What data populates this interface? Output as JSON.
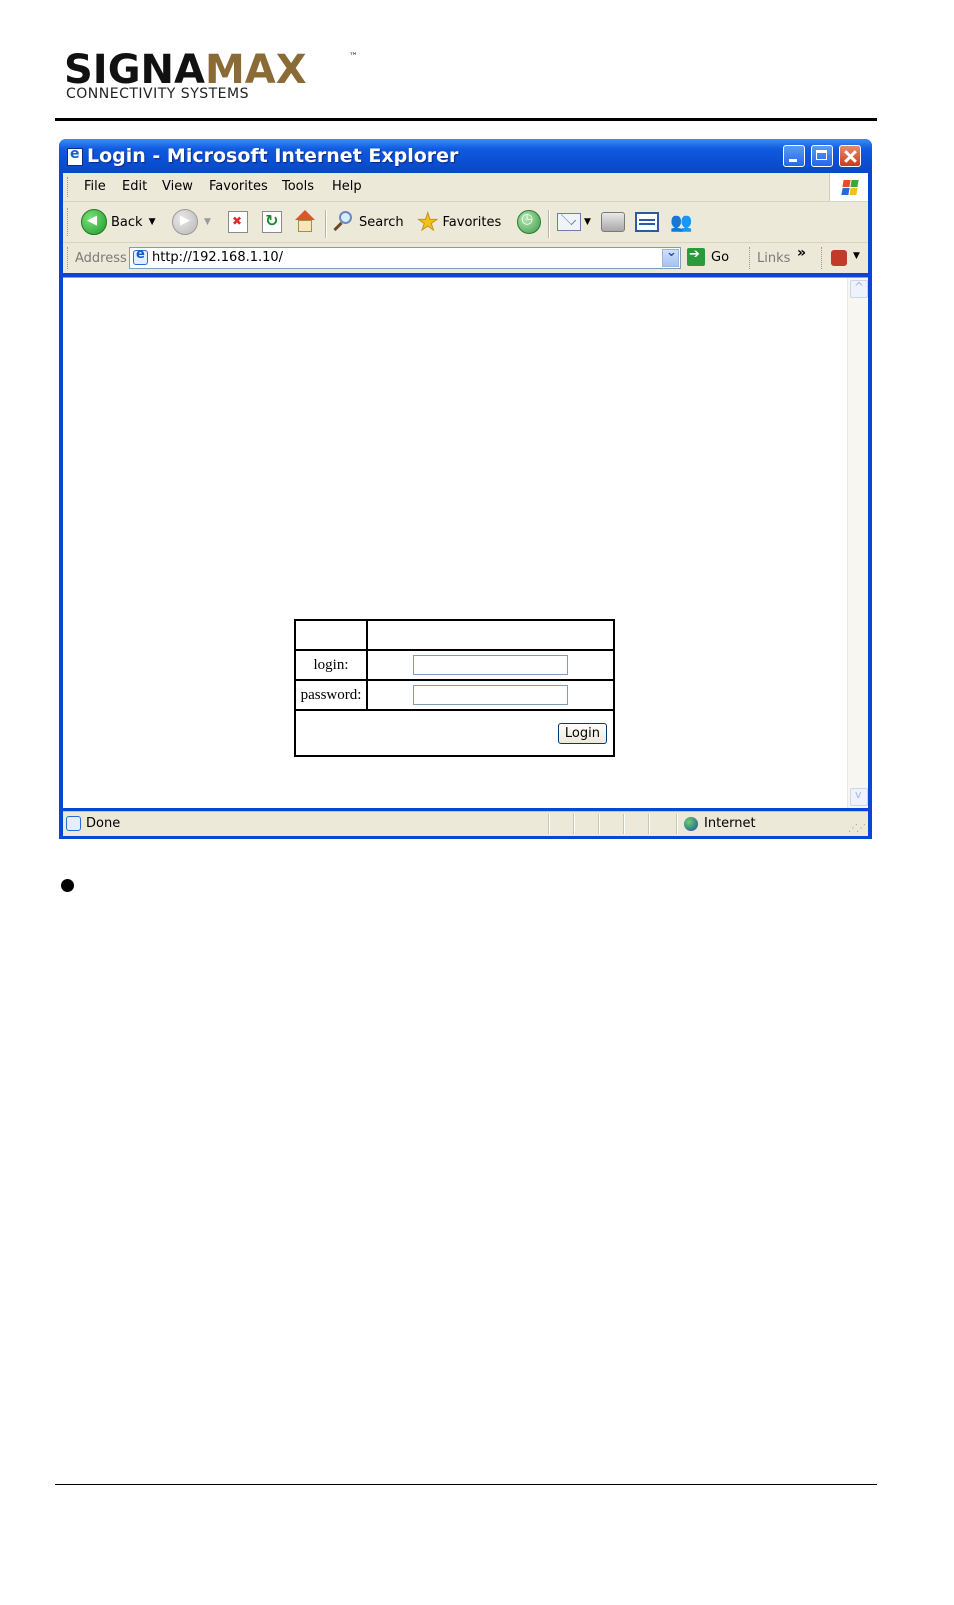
{
  "logo": {
    "word_dark": "SIGNA",
    "word_gold": "MAX",
    "tm": "™",
    "subtitle": "CONNECTIVITY SYSTEMS"
  },
  "window": {
    "title": "Login - Microsoft Internet Explorer"
  },
  "menu": [
    "File",
    "Edit",
    "View",
    "Favorites",
    "Tools",
    "Help"
  ],
  "toolbar": {
    "back_label": "Back",
    "search_label": "Search",
    "favorites_label": "Favorites"
  },
  "address_bar": {
    "label": "Address",
    "url": "http://192.168.1.10/",
    "go_label": "Go",
    "links_label": "Links",
    "links_more": "»"
  },
  "login_form": {
    "login_label": "login:",
    "password_label": "password:",
    "login_value": "",
    "password_value": "",
    "submit_label": "Login"
  },
  "status_bar": {
    "status_text": "Done",
    "zone_text": "Internet"
  },
  "colors": {
    "title_blue": "#0a4ed1",
    "chrome_bg": "#ece9d8",
    "logo_gold": "#8a6a35"
  }
}
